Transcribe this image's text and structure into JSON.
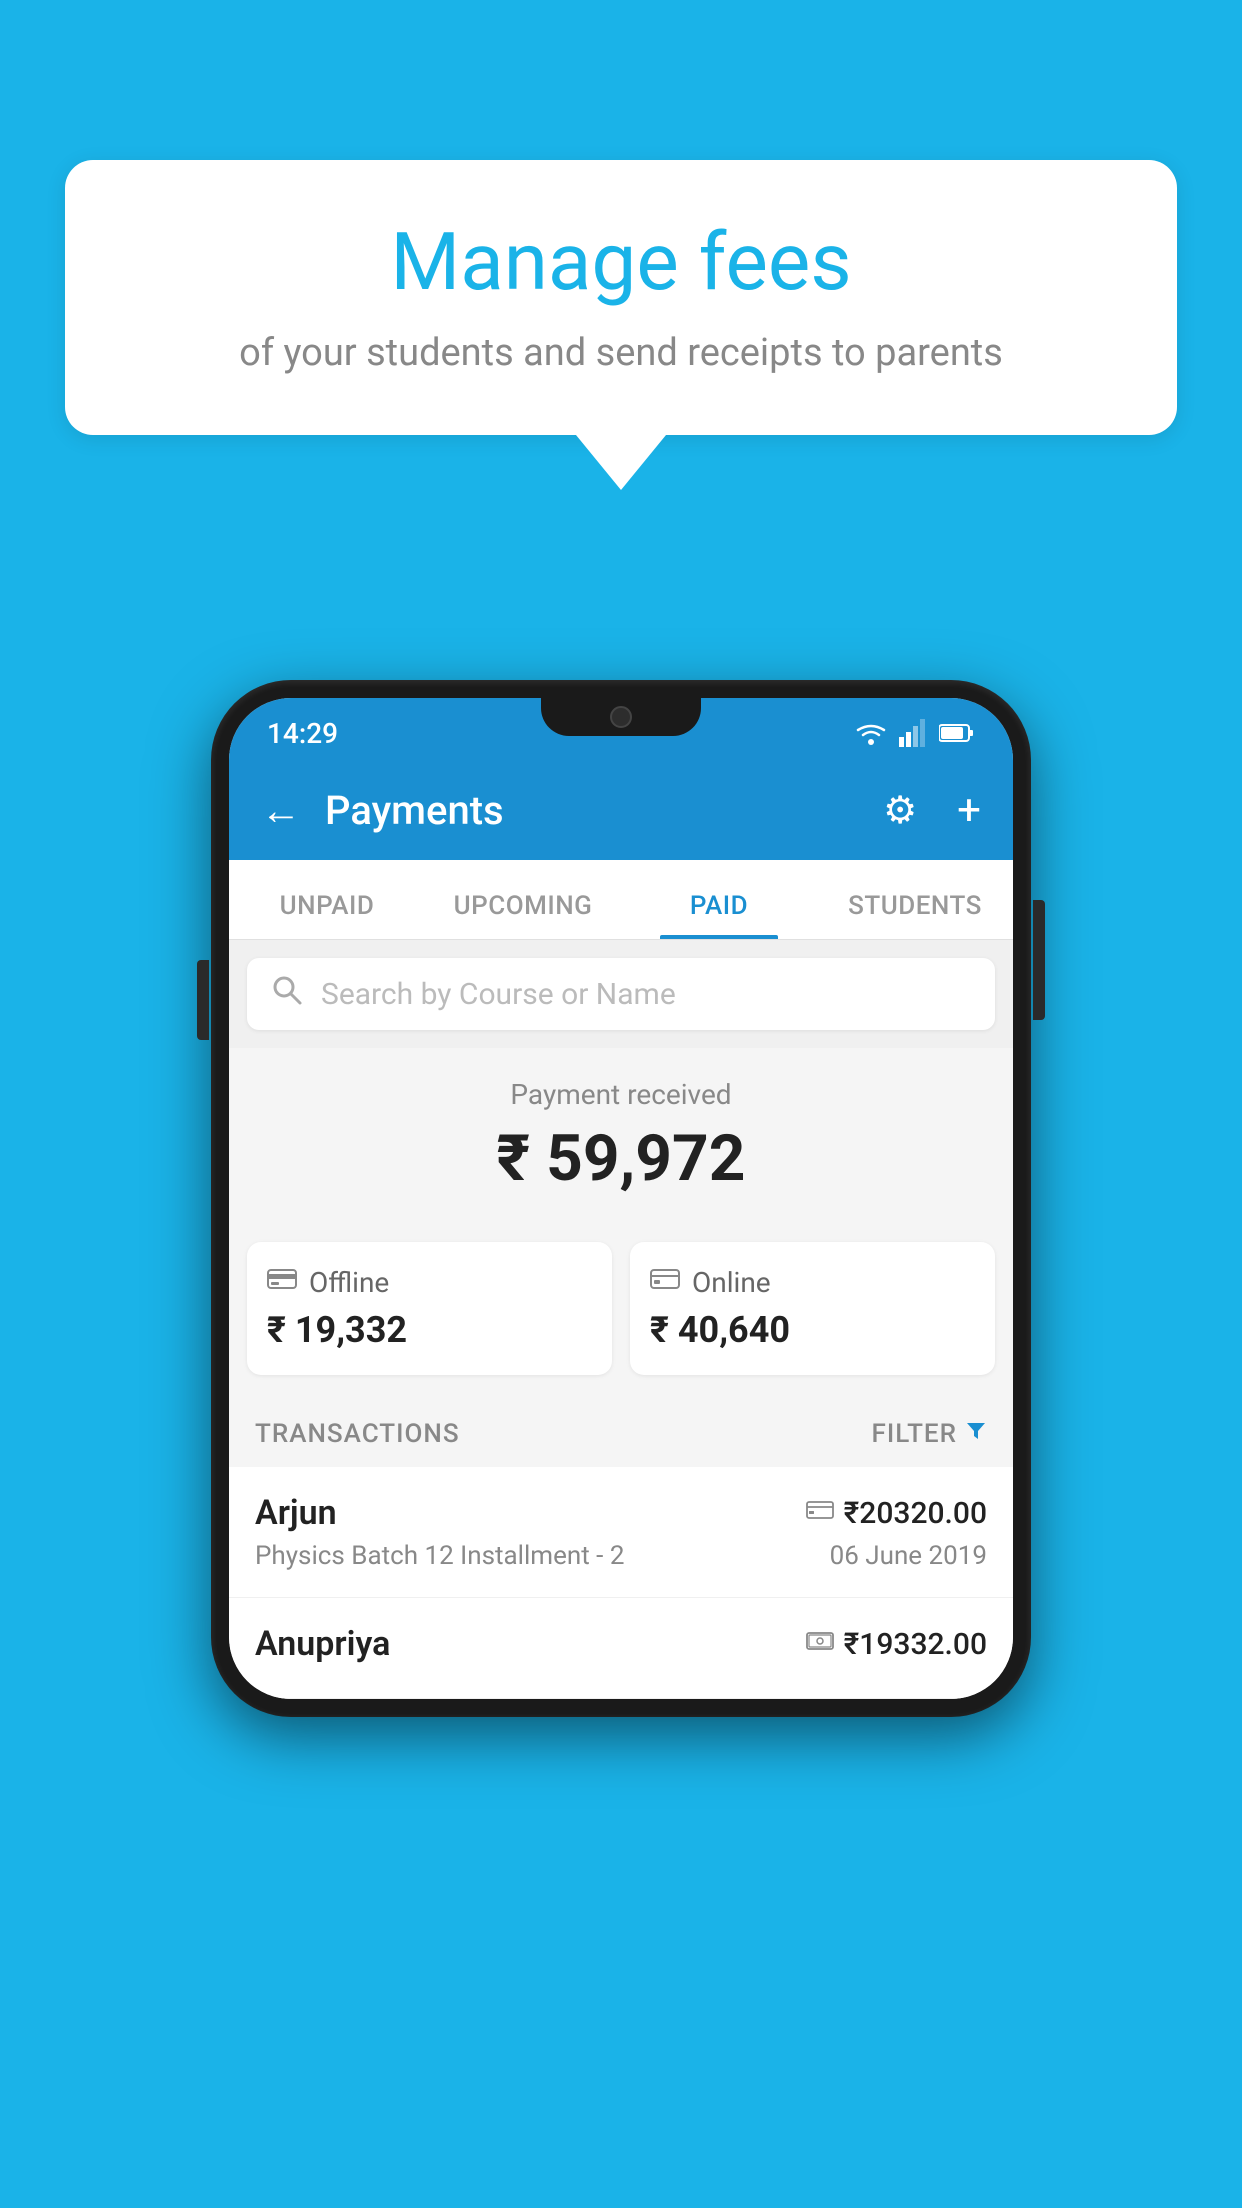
{
  "page": {
    "background_color": "#1ab3e8"
  },
  "speech_bubble": {
    "title": "Manage fees",
    "subtitle": "of your students and send receipts to parents"
  },
  "status_bar": {
    "time": "14:29"
  },
  "app_bar": {
    "title": "Payments",
    "back_label": "←",
    "gear_label": "⚙",
    "plus_label": "+"
  },
  "tabs": [
    {
      "label": "UNPAID",
      "active": false
    },
    {
      "label": "UPCOMING",
      "active": false
    },
    {
      "label": "PAID",
      "active": true
    },
    {
      "label": "STUDENTS",
      "active": false
    }
  ],
  "search": {
    "placeholder": "Search by Course or Name"
  },
  "payment_summary": {
    "label": "Payment received",
    "amount": "₹ 59,972",
    "offline_label": "Offline",
    "offline_amount": "₹ 19,332",
    "online_label": "Online",
    "online_amount": "₹ 40,640"
  },
  "transactions_header": {
    "label": "TRANSACTIONS",
    "filter_label": "FILTER"
  },
  "transactions": [
    {
      "name": "Arjun",
      "course": "Physics Batch 12 Installment - 2",
      "amount": "₹20320.00",
      "date": "06 June 2019",
      "mode": "card"
    },
    {
      "name": "Anupriya",
      "course": "",
      "amount": "₹19332.00",
      "date": "",
      "mode": "cash"
    }
  ]
}
